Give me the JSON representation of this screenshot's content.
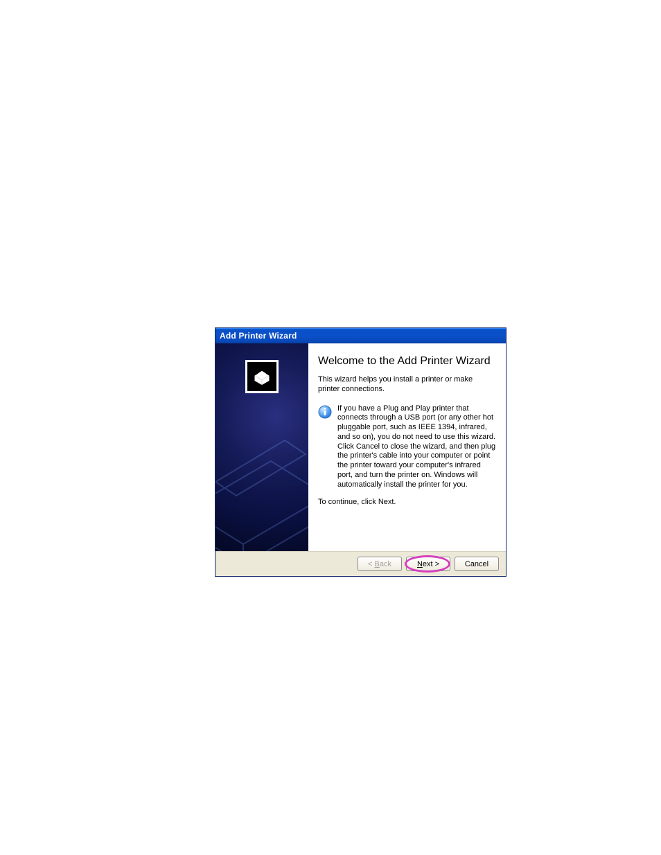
{
  "titlebar": {
    "text": "Add Printer Wizard"
  },
  "content": {
    "heading": "Welcome to the Add Printer Wizard",
    "intro": "This wizard helps you install a printer or make printer connections.",
    "info": "If you have a Plug and Play printer that connects through a USB port (or any other hot pluggable port, such as IEEE 1394, infrared, and so on), you do not need to use this wizard. Click Cancel to close the wizard, and then plug the printer's cable into your computer or point the printer toward your computer's infrared port, and turn the printer on. Windows will automatically install the printer for you.",
    "continue": "To continue, click Next."
  },
  "buttons": {
    "back_prefix": "< ",
    "back_mnemonic": "B",
    "back_rest": "ack",
    "next_mnemonic": "N",
    "next_rest": "ext >",
    "cancel": "Cancel"
  }
}
